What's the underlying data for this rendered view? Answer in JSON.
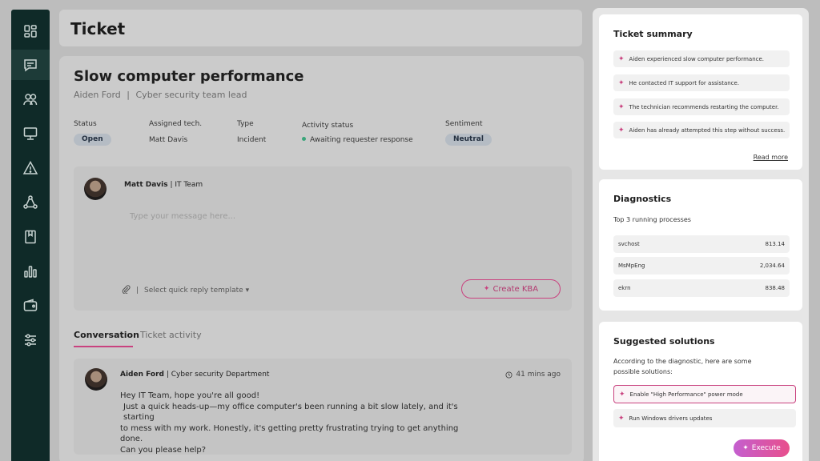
{
  "header": {
    "title": "Ticket"
  },
  "ticket": {
    "title": "Slow computer performance",
    "requester": "Aiden Ford",
    "separator": "|",
    "requester_role": "Cyber security team lead",
    "meta": {
      "status_label": "Status",
      "status_value": "Open",
      "tech_label": "Assigned tech.",
      "tech_value": "Matt Davis",
      "type_label": "Type",
      "type_value": "Incident",
      "activity_label": "Activity status",
      "activity_value": "Awaiting requester response",
      "sentiment_label": "Sentiment",
      "sentiment_value": "Neutral"
    }
  },
  "composer": {
    "author": "Matt Davis",
    "author_team": "| IT Team",
    "placeholder": "Type your message here...",
    "separator": "|",
    "template_label": "Select quick reply template",
    "kba_label": "Create KBA"
  },
  "tabs": [
    {
      "label": "Conversation"
    },
    {
      "label": "Ticket activity"
    }
  ],
  "message": {
    "author": "Aiden Ford",
    "author_dept": "| Cyber security Department",
    "time": "41 mins ago",
    "lines": [
      "Hey IT Team, hope you're all good!",
      "Just a quick heads-up—my office computer's been running a bit slow lately, and it's starting",
      "to mess with my work. Honestly, it's getting pretty frustrating trying to get anything done.",
      "Can you please help?"
    ]
  },
  "summary": {
    "title": "Ticket summary",
    "items": [
      "Aiden experienced slow computer performance.",
      "He contacted IT support for assistance.",
      "The technician recommends restarting the computer.",
      "Aiden has already attempted this step without success."
    ],
    "read_more": "Read more"
  },
  "diagnostics": {
    "title": "Diagnostics",
    "subtitle": "Top 3 running processes",
    "processes": [
      {
        "name": "svchost",
        "value": "813.14"
      },
      {
        "name": "MsMpEng",
        "value": "2,034.64"
      },
      {
        "name": "ekrn",
        "value": "838.48"
      }
    ]
  },
  "solutions": {
    "title": "Suggested solutions",
    "description_line1": "According to the diagnostic, here are some",
    "description_line2": "possible solutions:",
    "items": [
      {
        "label": "Enable \"High Performance\" power mode",
        "selected": true
      },
      {
        "label": "Run Windows drivers updates",
        "selected": false
      }
    ],
    "execute_label": "Execute"
  },
  "sidebar": {
    "items": [
      {
        "icon": "dashboard-icon",
        "active": false
      },
      {
        "icon": "tickets-icon",
        "active": true
      },
      {
        "icon": "users-icon",
        "active": false
      },
      {
        "icon": "monitor-icon",
        "active": false
      },
      {
        "icon": "alert-icon",
        "active": false
      },
      {
        "icon": "network-icon",
        "active": false
      },
      {
        "icon": "book-icon",
        "active": false
      },
      {
        "icon": "reports-icon",
        "active": false
      },
      {
        "icon": "wallet-icon",
        "active": false
      },
      {
        "icon": "settings-icon",
        "active": false
      }
    ]
  },
  "colors": {
    "accent": "#c9427f",
    "sidebar": "#0f2a28",
    "status_dot": "#3aa57a"
  }
}
